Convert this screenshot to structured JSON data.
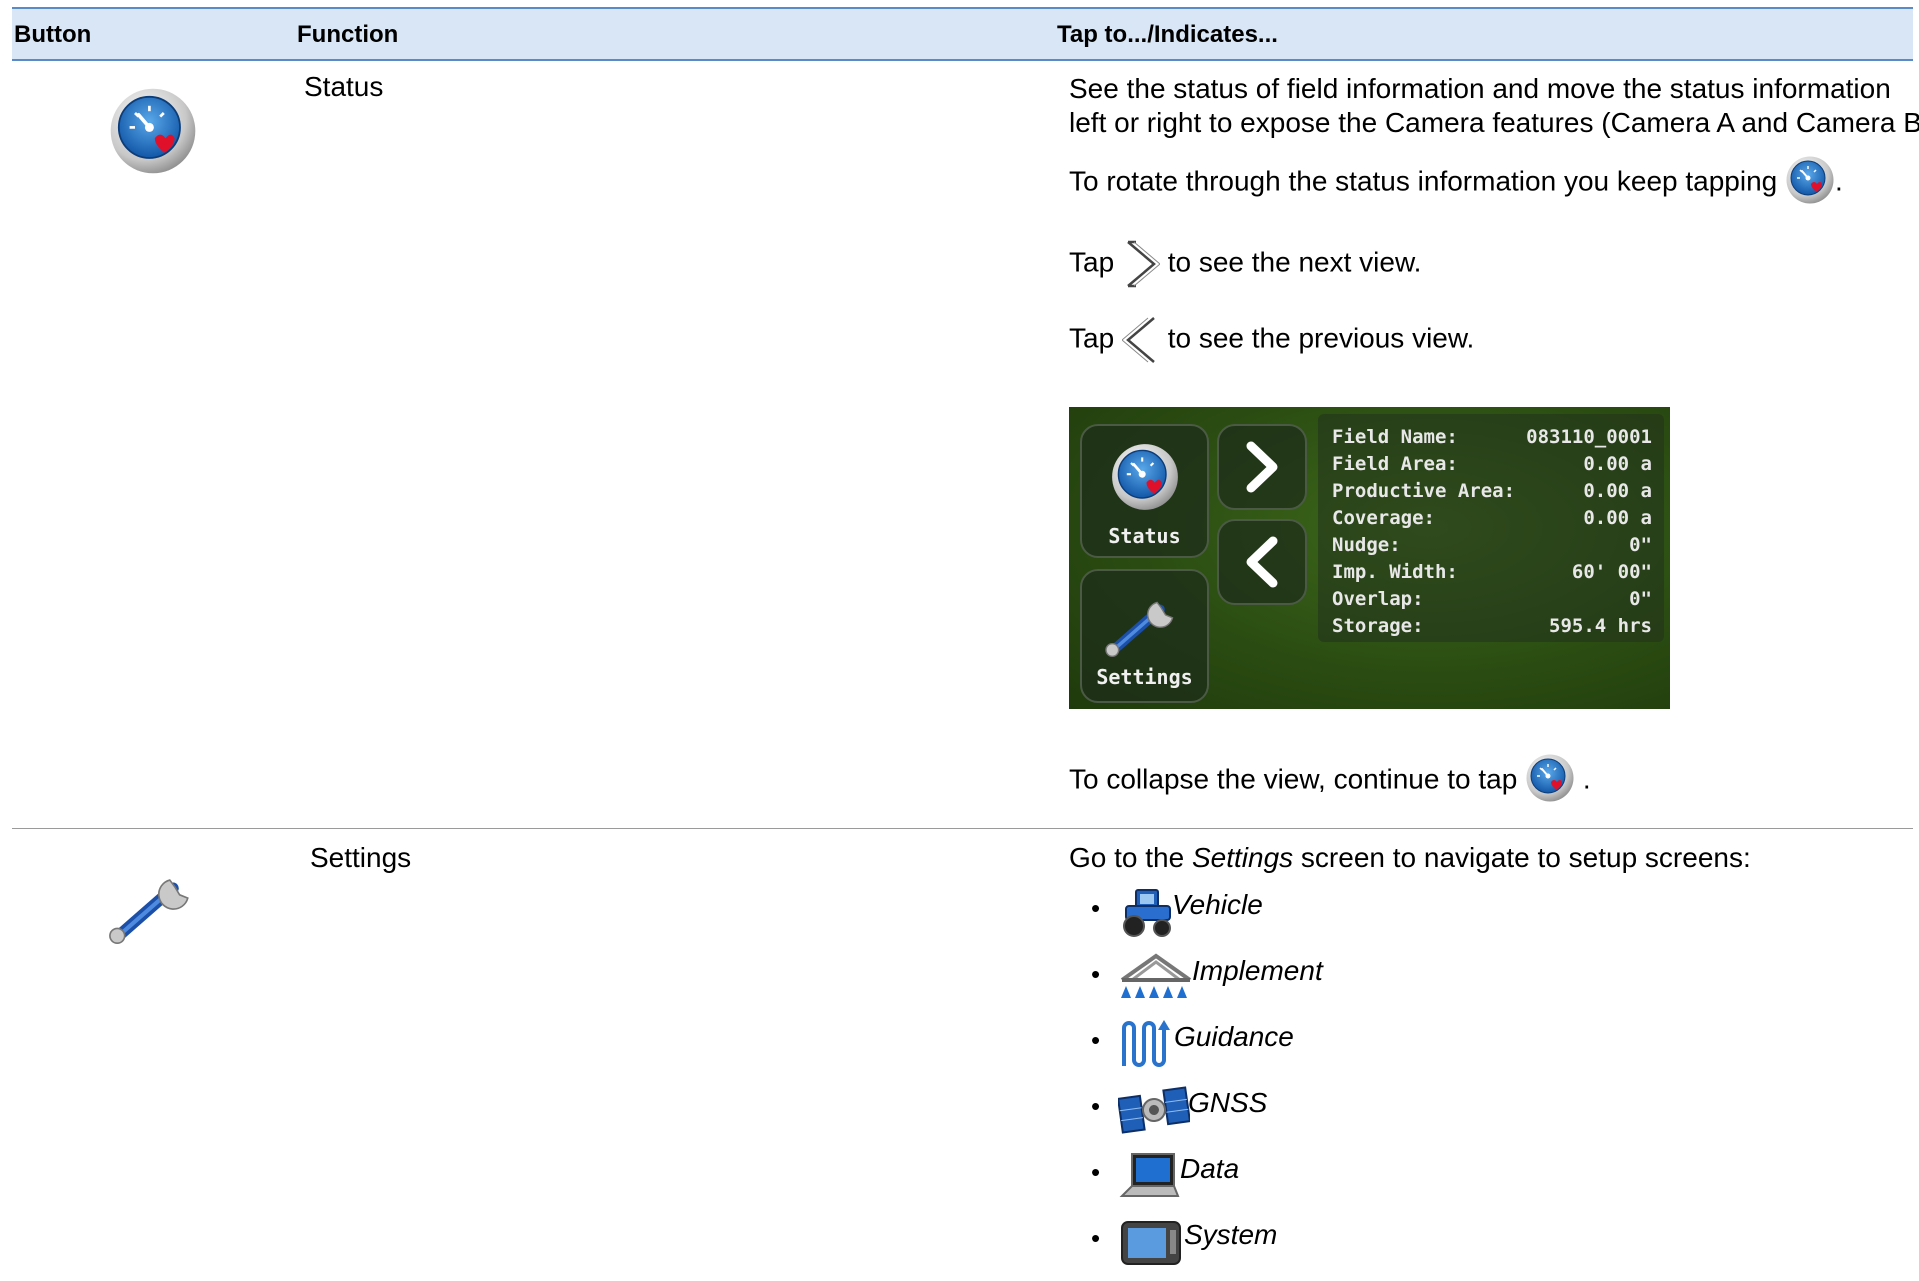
{
  "table": {
    "headers": [
      "Button",
      "Function",
      "Tap to.../Indicates..."
    ]
  },
  "status_row": {
    "icon": "status-gauge-icon",
    "function": "Status",
    "para1_line1": "See the status of field information and move the status information",
    "para1_line2": "left or right to expose the Camera features (Camera A and Camera B).",
    "para2": "To rotate through the status information you keep tapping",
    "para2_end": ".",
    "next_pre": "Tap",
    "next_post": "to see the next view.",
    "prev_pre": "Tap",
    "prev_post": "to see the previous view.",
    "panel": {
      "status_label": "Status",
      "settings_label": "Settings",
      "rows": [
        {
          "label": "Field Name:",
          "value": "083110_0001"
        },
        {
          "label": "Field Area:",
          "value": "0.00 a"
        },
        {
          "label": "Productive Area:",
          "value": "0.00 a"
        },
        {
          "label": "Coverage:",
          "value": "0.00 a"
        },
        {
          "label": "Nudge:",
          "value": "0\""
        },
        {
          "label": "Imp. Width:",
          "value": "60' 00\""
        },
        {
          "label": "Overlap:",
          "value": "0\""
        },
        {
          "label": "Storage:",
          "value": "595.4 hrs"
        }
      ]
    },
    "collapse": "To collapse the view, continue to tap",
    "collapse_end": "."
  },
  "settings_row": {
    "icon": "wrench-icon",
    "function": "Settings",
    "intro_pre": "Go to the ",
    "intro_em": "Settings",
    "intro_post": " screen to navigate to setup screens:",
    "items": [
      {
        "label": "Vehicle",
        "icon": "tractor-icon"
      },
      {
        "label": "Implement",
        "icon": "implement-icon"
      },
      {
        "label": "Guidance",
        "icon": "guidance-icon"
      },
      {
        "label": "GNSS",
        "icon": "satellite-icon"
      },
      {
        "label": "Data",
        "icon": "laptop-icon"
      },
      {
        "label": "System",
        "icon": "display-icon"
      }
    ]
  }
}
